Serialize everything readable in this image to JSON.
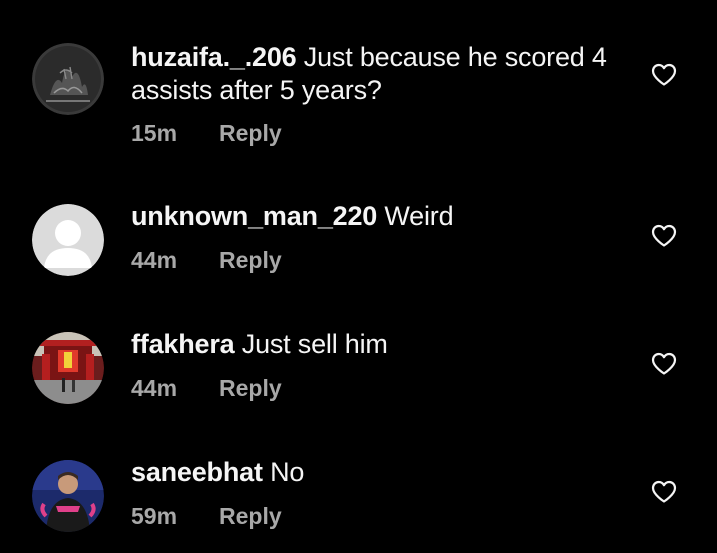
{
  "colors": {
    "background": "#000000",
    "text": "#f5f5f5",
    "meta": "#a8a8a8"
  },
  "comments": [
    {
      "username": "huzaifa._.206",
      "text": "Just because he scored 4 assists after 5 years?",
      "time": "15m",
      "reply_label": "Reply",
      "avatar_icon": "dark-sketch-avatar",
      "like_icon": "heart-outline-icon"
    },
    {
      "username": "unknown_man_220",
      "text": "Weird",
      "time": "44m",
      "reply_label": "Reply",
      "avatar_icon": "default-person-avatar",
      "like_icon": "heart-outline-icon"
    },
    {
      "username": "ffakhera",
      "text": "Just sell him",
      "time": "44m",
      "reply_label": "Reply",
      "avatar_icon": "temple-gate-photo-avatar",
      "like_icon": "heart-outline-icon"
    },
    {
      "username": "saneebhat",
      "text": "No",
      "time": "59m",
      "reply_label": "Reply",
      "avatar_icon": "goalkeeper-photo-avatar",
      "like_icon": "heart-outline-icon"
    }
  ]
}
